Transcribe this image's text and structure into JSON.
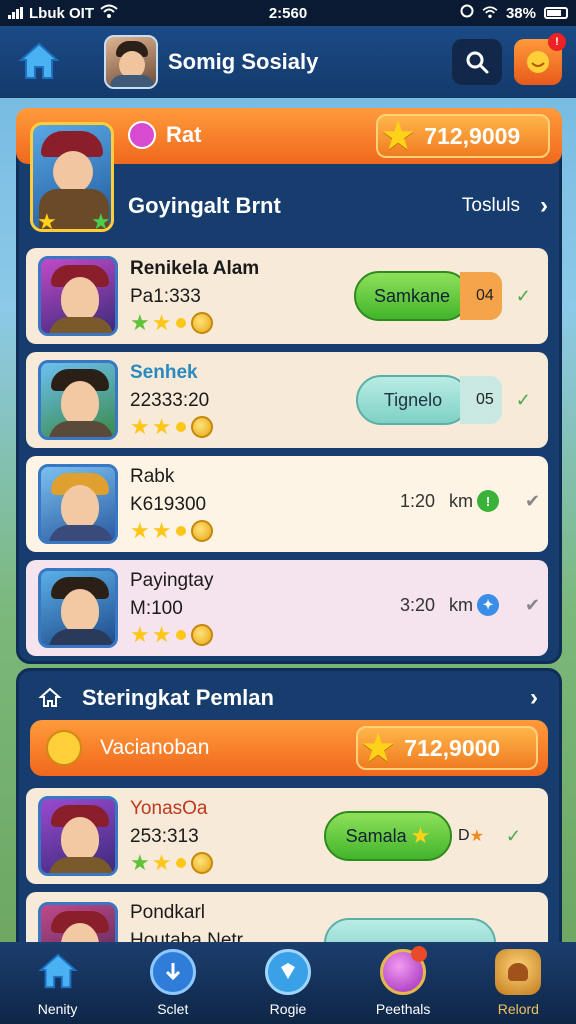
{
  "status_bar": {
    "carrier": "Lbuk OIT",
    "time": "2:560",
    "battery": "38%"
  },
  "header": {
    "title": "Somig Sosialy"
  },
  "panel1": {
    "tab_label": "Rat",
    "score": "712,9009",
    "section_title": "Goyingalt Brnt",
    "section_link": "Tosluls"
  },
  "rows": [
    {
      "name": "Renikela Alam",
      "sub": "Pa1:333",
      "button": "Samkane",
      "tag": "04",
      "name_color": "#1b1b1b",
      "bg": "#f7ead8"
    },
    {
      "name": "Senhek",
      "sub": "22333:20",
      "button": "Tignelo",
      "tag": "05",
      "name_color": "#2a8ac0",
      "bg": "#f7ead8"
    },
    {
      "name": "Rabk",
      "sub": "K619300",
      "time": "1:20",
      "unit": "km",
      "name_color": "#1b1b1b",
      "bg": "#fdf4e6"
    },
    {
      "name": "Payingtay",
      "sub": "M:100",
      "time": "3:20",
      "unit": "km",
      "name_color": "#1b1b1b",
      "bg": "#f5e3ee"
    }
  ],
  "panel2": {
    "section_title": "Steringkat Pemlan",
    "bar_label": "Vacianoban",
    "score": "712,9000"
  },
  "rows2": [
    {
      "name": "YonasOa",
      "sub": "253:313",
      "button": "Samala",
      "tag": "D",
      "name_color": "#c0391e"
    },
    {
      "name": "Pondkarl",
      "sub": "Houtaba Netr"
    }
  ],
  "nav": [
    {
      "label": "Nenity",
      "icon": "home-icon",
      "color": "#3a8ee8"
    },
    {
      "label": "Sclet",
      "icon": "download-icon",
      "color": "#2f7dd8"
    },
    {
      "label": "Rogie",
      "icon": "shield-icon",
      "color": "#3aa0e8"
    },
    {
      "label": "Peethals",
      "icon": "orb-icon",
      "color": "#c24ad6"
    },
    {
      "label": "Relord",
      "icon": "trophy-icon",
      "color": "#e6a93a"
    }
  ],
  "colors": {
    "accent_orange": "#f0681e",
    "panel_blue": "#173d6e",
    "header_blue": "#1b4a86"
  }
}
